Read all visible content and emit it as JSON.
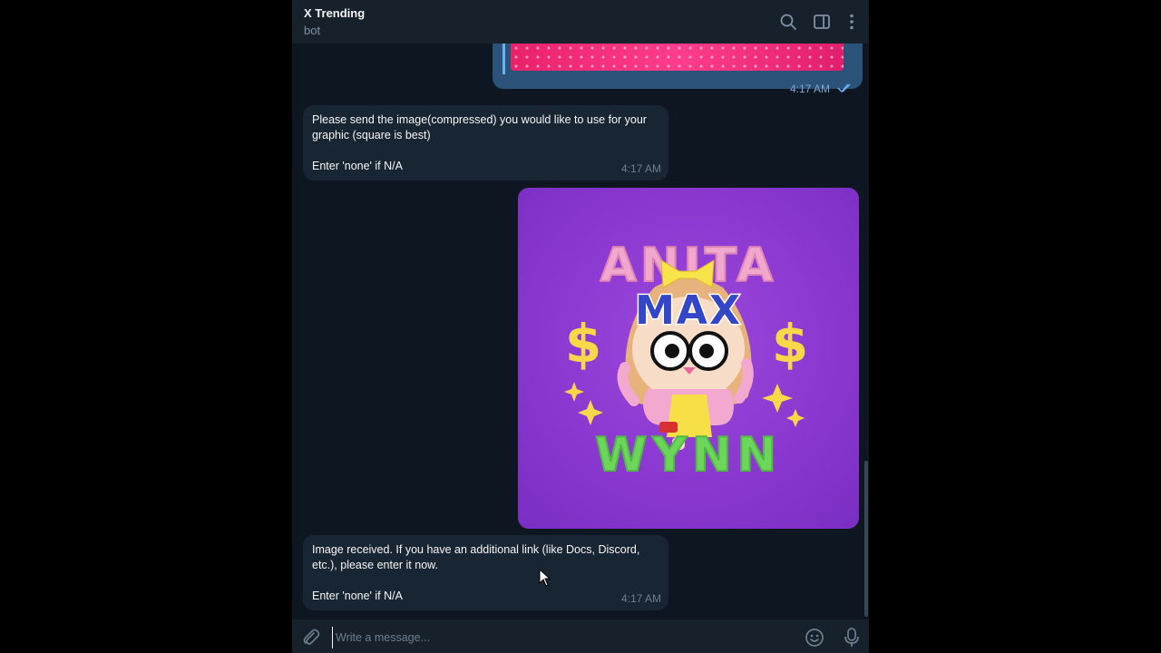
{
  "header": {
    "title": "X Trending",
    "status": "bot"
  },
  "messages": {
    "outgoing_image_time": "4:17 AM",
    "incoming_1_text": "Please send the image(compressed) you would like to use for your graphic (square is best)\n\nEnter 'none' if N/A",
    "incoming_1_time": "4:17 AM",
    "photo_text_top": "ANITA",
    "photo_text_middle": "MAX",
    "photo_text_bottom": "WYNN",
    "photo_symbol": "$",
    "incoming_2_text": "Image received. If you have an additional link (like Docs, Discord, etc.), please enter it now.\n\nEnter 'none' if N/A",
    "incoming_2_time": "4:17 AM"
  },
  "composer": {
    "placeholder": "Write a message..."
  },
  "icons": [
    "search-icon",
    "sidebar-icon",
    "more-icon",
    "attach-icon",
    "emoji-icon",
    "microphone-icon"
  ],
  "colors": {
    "chat_background": "#0e1621",
    "header_background": "#17212b",
    "incoming_bubble": "#182533",
    "outgoing_bubble": "#2b5278",
    "photo_purple": "#8a38cf"
  }
}
